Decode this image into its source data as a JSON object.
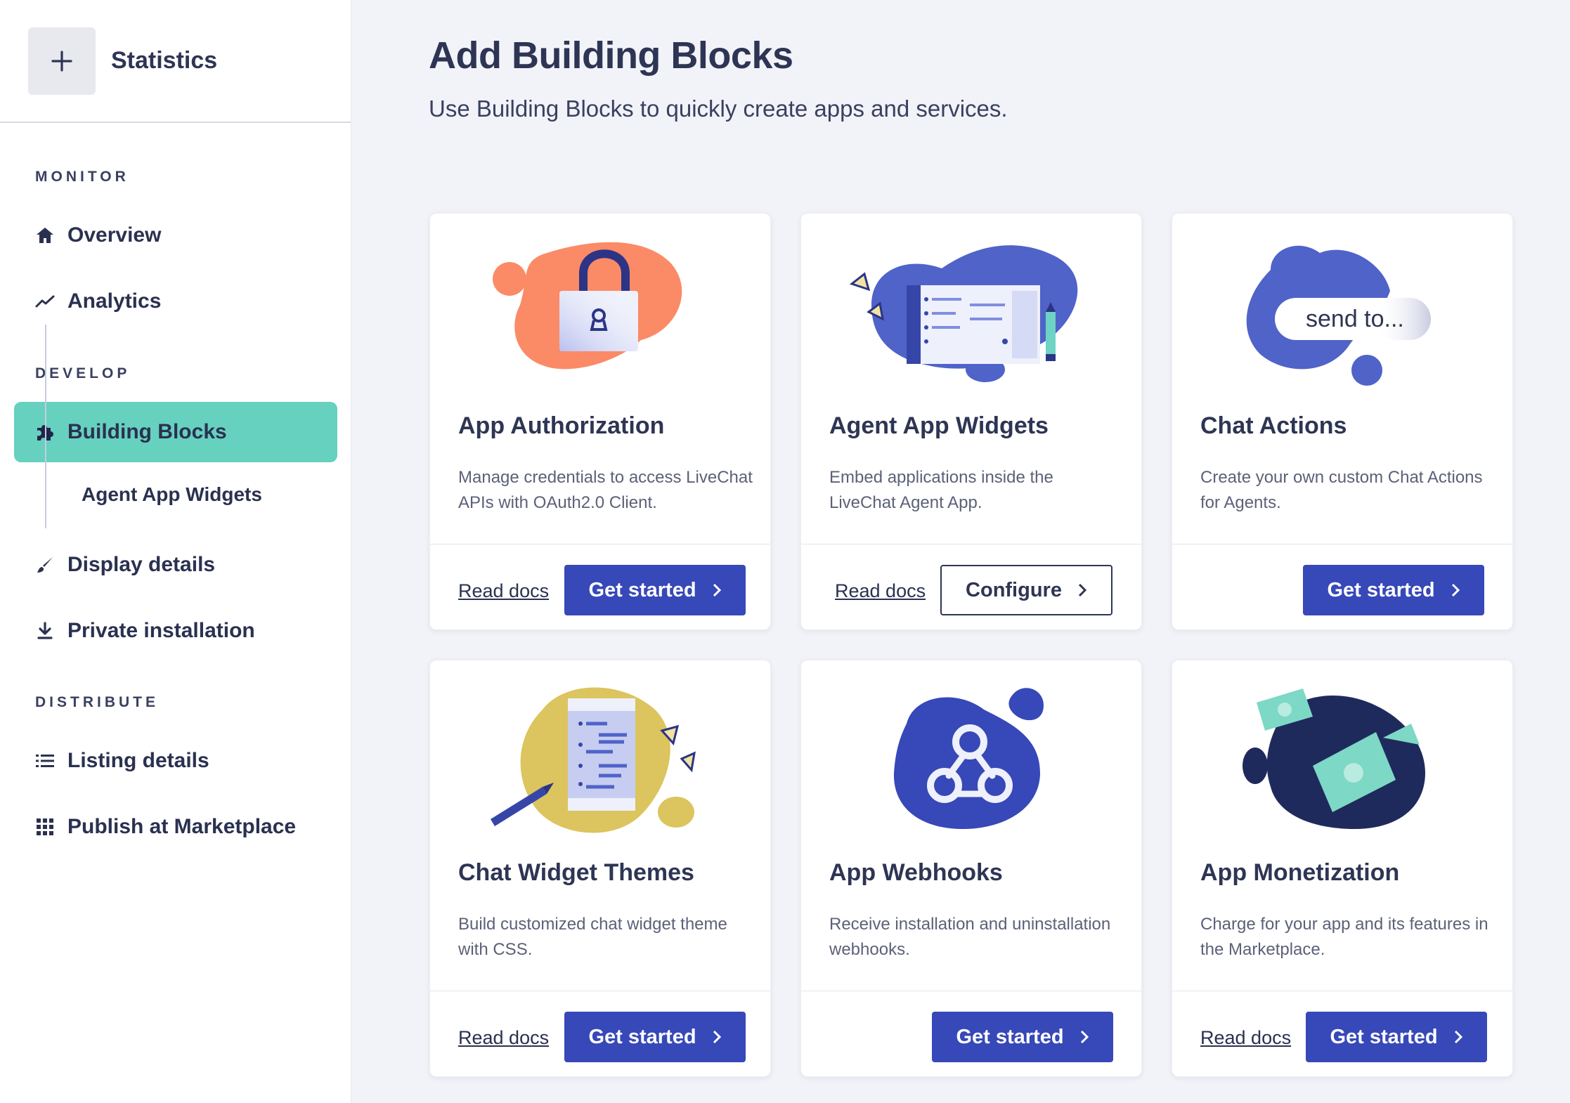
{
  "app": {
    "title": "Statistics",
    "icon": "plus-icon"
  },
  "sidebar": {
    "sections": {
      "monitor": "MONITOR",
      "develop": "DEVELOP",
      "distribute": "DISTRIBUTE"
    },
    "items": [
      {
        "label": "Overview",
        "icon": "home-icon"
      },
      {
        "label": "Analytics",
        "icon": "trend-icon"
      },
      {
        "label": "Building Blocks",
        "icon": "puzzle-icon",
        "active": true
      },
      {
        "label": "Agent App Widgets"
      },
      {
        "label": "Display details",
        "icon": "brush-icon"
      },
      {
        "label": "Private installation",
        "icon": "download-icon"
      },
      {
        "label": "Listing details",
        "icon": "list-icon"
      },
      {
        "label": "Publish at Marketplace",
        "icon": "grid-icon"
      }
    ],
    "active_color": "#66d1bf"
  },
  "main": {
    "title": "Add Building Blocks",
    "subtitle": "Use Building Blocks to quickly create apps and services."
  },
  "cards": [
    {
      "title": "App Authorization",
      "desc": "Manage credentials to access LiveChat APIs with OAuth2.0 Client.",
      "read_docs": "Read docs",
      "button": "Get started",
      "illustration": "padlock-illustration"
    },
    {
      "title": "Agent App Widgets",
      "desc": "Embed applications inside the LiveChat Agent App.",
      "read_docs": "Read docs",
      "button": "Configure",
      "illustration": "widget-illustration"
    },
    {
      "title": "Chat Actions",
      "desc": "Create your own custom Chat Actions for Agents.",
      "button": "Get started",
      "illustration": "send-to-illustration",
      "illus_text": "send to..."
    },
    {
      "title": "Chat Widget Themes",
      "desc": "Build customized chat widget theme with CSS.",
      "read_docs": "Read docs",
      "button": "Get started",
      "illustration": "themes-illustration"
    },
    {
      "title": "App Webhooks",
      "desc": "Receive installation and uninstallation webhooks.",
      "button": "Get started",
      "illustration": "webhook-illustration"
    },
    {
      "title": "App Monetization",
      "desc": "Charge for your app and its features in the Marketplace.",
      "read_docs": "Read docs",
      "button": "Get started",
      "illustration": "money-illustration"
    }
  ],
  "colors": {
    "primary_button": "#3748b8",
    "text_dark": "#2e3554",
    "page_bg": "#f2f3f8"
  }
}
